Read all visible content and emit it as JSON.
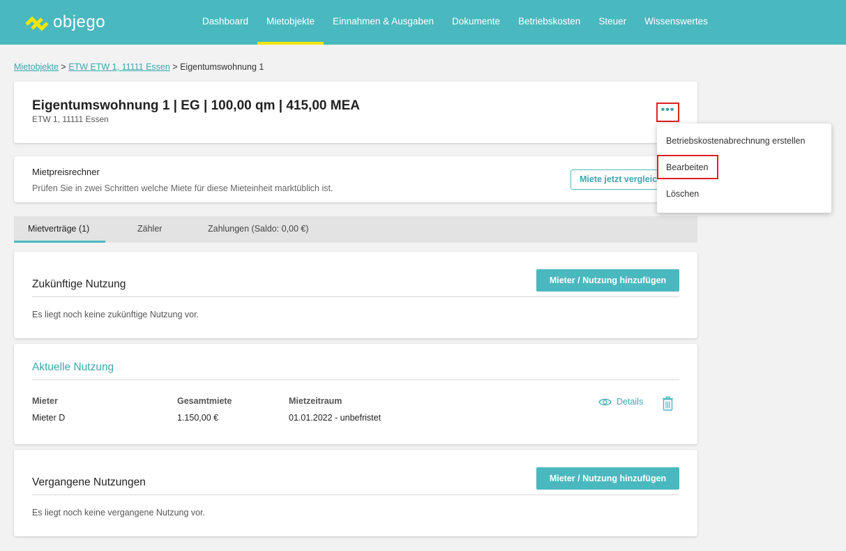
{
  "app": {
    "logo_text": "objego",
    "brand_color": "#4ab8bf",
    "active_nav_color": "#f2e600",
    "highlight_color": "#e02020"
  },
  "nav": {
    "items": [
      "Dashboard",
      "Mietobjekte",
      "Einnahmen & Ausgaben",
      "Dokumente",
      "Betriebskosten",
      "Steuer",
      "Wissenswertes"
    ],
    "active": "Mietobjekte"
  },
  "breadcrumb": {
    "link1": "Mietobjekte",
    "sep1": " > ",
    "link2": "ETW ETW 1, 11111 Essen",
    "sep2": " > ",
    "current": "Eigentumswohnung 1"
  },
  "unit": {
    "title": "Eigentumswohnung 1 | EG | 100,00 qm | 415,00 MEA",
    "address": "ETW 1, 11111 Essen",
    "more_icon": "more-horizontal-icon",
    "more_label": "•••"
  },
  "rent_calculator": {
    "title": "Mietpreisrechner",
    "description": "Prüfen Sie in zwei Schritten welche Miete für diese Mieteinheit marktüblich ist.",
    "button": "Miete jetzt vergleichen"
  },
  "tabs": [
    "Mietverträge (1)",
    "Zähler",
    "Zahlungen (Saldo: 0,00 €)"
  ],
  "future": {
    "title": "Zukünftige Nutzung",
    "button": "Mieter / Nutzung hinzufügen",
    "empty": "Es liegt noch keine zukünftige Nutzung vor."
  },
  "current": {
    "title": "Aktuelle Nutzung",
    "columns": [
      "Mieter",
      "Gesamtmiete",
      "Mietzeitraum"
    ],
    "row": {
      "tenant": "Mieter D",
      "total_rent": "1.150,00 €",
      "period": "01.01.2022 - unbefristet"
    },
    "details_label": "Details",
    "details_icon": "eye-icon",
    "delete_icon": "trash-icon"
  },
  "past": {
    "title": "Vergangene Nutzungen",
    "button": "Mieter / Nutzung hinzufügen",
    "empty": "Es liegt noch keine vergangene Nutzung vor."
  },
  "dropdown": {
    "items": [
      "Betriebskostenabrechnung erstellen",
      "Bearbeiten",
      "Löschen"
    ],
    "highlighted": "Bearbeiten"
  }
}
